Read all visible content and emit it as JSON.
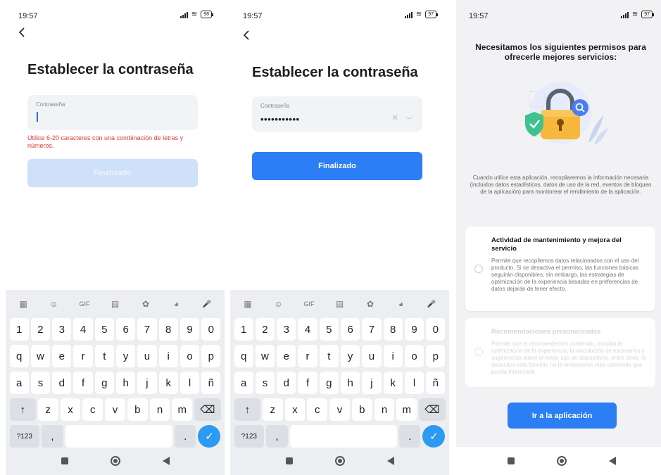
{
  "screen1": {
    "status": {
      "time": "19:57",
      "battery": "98"
    },
    "title": "Establecer la contraseña",
    "field_label": "Contraseña",
    "error": "Utilice 6-20 caracteres con una combinación de letras y números.",
    "button": "Finalizado"
  },
  "screen2": {
    "status": {
      "time": "19:57",
      "battery": "97"
    },
    "title": "Establecer la contraseña",
    "field_label": "Contraseña",
    "field_value": "•••••••••••",
    "button": "Finalizado"
  },
  "keyboard": {
    "toolbar": [
      "▦",
      "☺",
      "GIF",
      "▤",
      "✿",
      "◕",
      "🎤"
    ],
    "numbers": [
      "1",
      "2",
      "3",
      "4",
      "5",
      "6",
      "7",
      "8",
      "9",
      "0"
    ],
    "row1": [
      "q",
      "w",
      "e",
      "r",
      "t",
      "y",
      "u",
      "i",
      "o",
      "p"
    ],
    "row2": [
      "a",
      "s",
      "d",
      "f",
      "g",
      "h",
      "j",
      "k",
      "l",
      "ñ"
    ],
    "row3": [
      "↑",
      "z",
      "x",
      "c",
      "v",
      "b",
      "n",
      "m",
      "⌫"
    ],
    "row4": [
      "?123",
      ",",
      "",
      ".",
      "✓"
    ]
  },
  "screen3": {
    "status": {
      "time": "19:57",
      "battery": "97"
    },
    "title": "Necesitamos los siguientes permisos para ofrecerle mejores servicios:",
    "description": "Cuando utilice esta aplicación, recopilaremos la información necesaria (incluidos datos estadísticos, datos de uso de la red, eventos de bloqueo de la aplicación) para monitorear el rendimiento de la aplicación.",
    "card1": {
      "title": "Actividad de mantenimiento y mejora del servicio",
      "text": "Permite que recopilemos datos relacionados con el uso del producto. Si se desactiva el permiso, las funciones básicas seguirán disponibles; sin embargo, las estrategias de optimización de la experiencia basadas en preferencias de datos dejarán de tener efecto."
    },
    "card2": {
      "title": "Recomendaciones personalizadas",
      "text": "Permite que le recomendemos contenido, incluida la optimización de la experiencia, la vinculación de escenarios y sugerencias sobre el mejor uso de dispositivos, entre otros. Si desactiva esta función, no le enviaremos más contenido que pueda interesarle."
    },
    "button": "Ir a la aplicación"
  },
  "colors": {
    "accent": "#2b7ef3",
    "error": "#e53935",
    "disabled": "#cfe0fb"
  }
}
